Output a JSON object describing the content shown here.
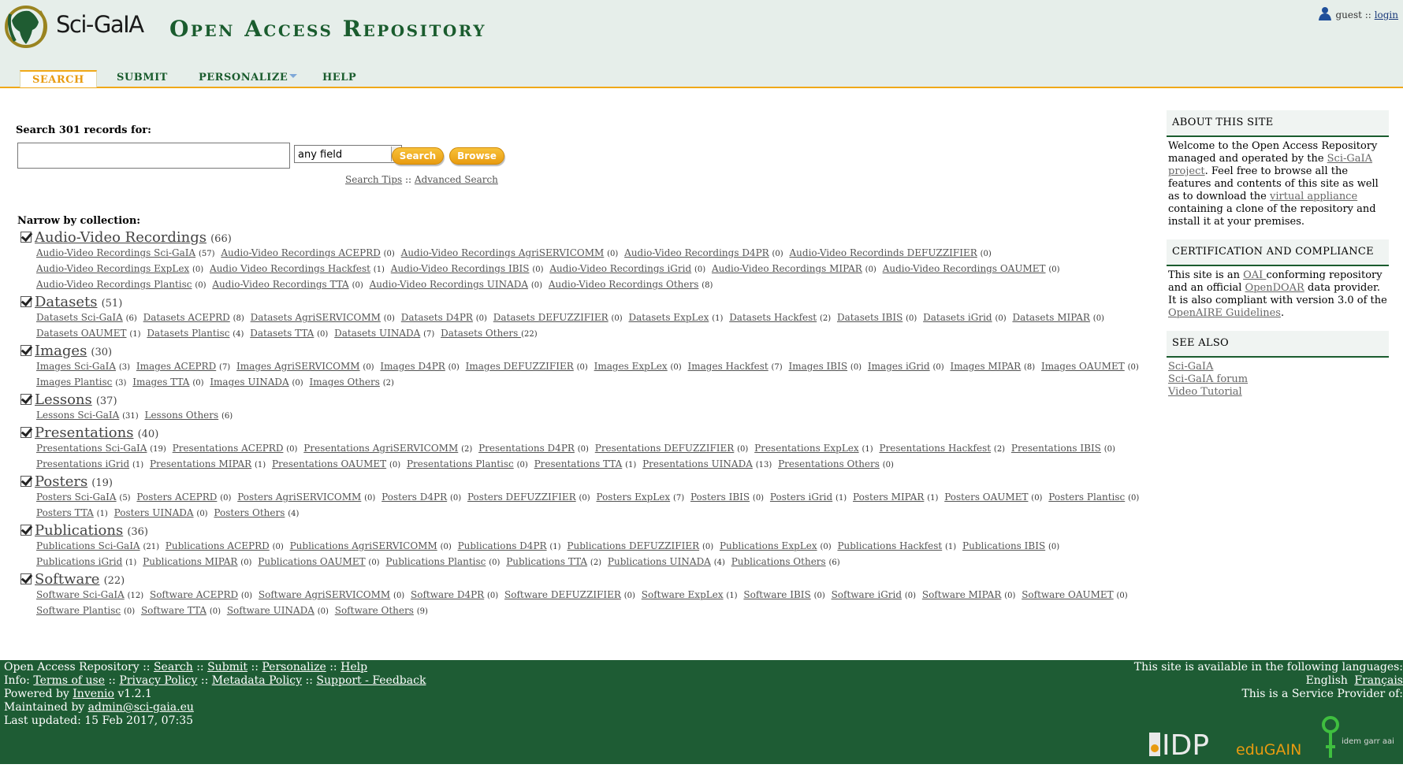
{
  "header": {
    "logo_text": "Sci-GaIA",
    "site_title": "Open Access Repository",
    "user": "guest",
    "separator": "::",
    "login_label": "login"
  },
  "nav": {
    "tabs": [
      {
        "label": "SEARCH",
        "active": true
      },
      {
        "label": "SUBMIT"
      },
      {
        "label": "PERSONALIZE",
        "has_menu": true
      },
      {
        "label": "HELP"
      }
    ]
  },
  "search": {
    "label": "Search 301 records for:",
    "input_value": "",
    "field_value": "any field",
    "search_button": "Search",
    "browse_button": "Browse",
    "tips_link": "Search Tips",
    "tips_sep": "::",
    "advanced_link": "Advanced Search"
  },
  "narrow_label": "Narrow by collection:",
  "collections": [
    {
      "name": "Audio-Video Recordings",
      "count": "(66)",
      "subs": [
        [
          "Audio-Video Recordings Sci-GaIA",
          "(57)"
        ],
        [
          "Audio-Video Recordings ACEPRD",
          "(0)"
        ],
        [
          "Audio-Video Recordings AgriSERVICOMM",
          "(0)"
        ],
        [
          "Audio-Video Recordings D4PR",
          "(0)"
        ],
        [
          "Audio-Video Recordinds DEFUZZIFIER",
          "(0)"
        ],
        [
          "Audio-Video Recordings ExpLex",
          "(0)"
        ],
        [
          "Audio Video Recordings Hackfest",
          "(1)"
        ],
        [
          "Audio-Video Recordings IBIS",
          "(0)"
        ],
        [
          "Audio-Video Recordings iGrid",
          "(0)"
        ],
        [
          "Audio-Video Recordings MIPAR",
          "(0)"
        ],
        [
          "Audio-Video Recordings OAUMET",
          "(0)"
        ],
        [
          "Audio-Video Recordings Plantisc",
          "(0)"
        ],
        [
          "Audio-Video Recordings TTA",
          "(0)"
        ],
        [
          "Audio-Video Recordings UINADA",
          "(0)"
        ],
        [
          "Audio-Video Recordings Others",
          "(8)"
        ]
      ]
    },
    {
      "name": "Datasets",
      "count": "(51)",
      "subs": [
        [
          "Datasets Sci-GaIA",
          "(6)"
        ],
        [
          "Datasets ACEPRD",
          "(8)"
        ],
        [
          "Datasets AgriSERVICOMM",
          "(0)"
        ],
        [
          "Datasets D4PR",
          "(0)"
        ],
        [
          "Datasets DEFUZZIFIER",
          "(0)"
        ],
        [
          "Datasets ExpLex",
          "(1)"
        ],
        [
          "Datasets Hackfest",
          "(2)"
        ],
        [
          "Datasets IBIS",
          "(0)"
        ],
        [
          "Datasets iGrid",
          "(0)"
        ],
        [
          "Datasets MIPAR",
          "(0)"
        ],
        [
          "Datasets OAUMET",
          "(1)"
        ],
        [
          "Datasets Plantisc",
          "(4)"
        ],
        [
          "Datasets TTA",
          "(0)"
        ],
        [
          "Datasets UINADA",
          "(7)"
        ],
        [
          "Datasets Others ",
          "(22)"
        ]
      ]
    },
    {
      "name": "Images",
      "count": "(30)",
      "subs": [
        [
          "Images Sci-GaIA",
          "(3)"
        ],
        [
          "Images ACEPRD",
          "(7)"
        ],
        [
          "Images AgriSERVICOMM",
          "(0)"
        ],
        [
          "Images D4PR",
          "(0)"
        ],
        [
          "Images DEFUZZIFIER",
          "(0)"
        ],
        [
          "Images ExpLex",
          "(0)"
        ],
        [
          "Images Hackfest",
          "(7)"
        ],
        [
          "Images IBIS",
          "(0)"
        ],
        [
          "Images iGrid",
          "(0)"
        ],
        [
          "Images MIPAR",
          "(8)"
        ],
        [
          "Images OAUMET",
          "(0)"
        ],
        [
          "Images Plantisc",
          "(3)"
        ],
        [
          "Images TTA",
          "(0)"
        ],
        [
          "Images UINADA",
          "(0)"
        ],
        [
          "Images Others",
          "(2)"
        ]
      ]
    },
    {
      "name": "Lessons",
      "count": "(37)",
      "subs": [
        [
          "Lessons Sci-GaIA",
          "(31)"
        ],
        [
          "Lessons Others",
          "(6)"
        ]
      ]
    },
    {
      "name": "Presentations",
      "count": "(40)",
      "subs": [
        [
          "Presentations Sci-GaIA",
          "(19)"
        ],
        [
          "Presentations ACEPRD",
          "(0)"
        ],
        [
          "Presentations AgriSERVICOMM",
          "(2)"
        ],
        [
          "Presentations D4PR",
          "(0)"
        ],
        [
          "Presentations DEFUZZIFIER",
          "(0)"
        ],
        [
          "Presentations ExpLex",
          "(1)"
        ],
        [
          "Presentations Hackfest",
          "(2)"
        ],
        [
          "Presentations IBIS",
          "(0)"
        ],
        [
          "Presentations iGrid",
          "(1)"
        ],
        [
          "Presentations MIPAR",
          "(1)"
        ],
        [
          "Presentations OAUMET",
          "(0)"
        ],
        [
          "Presentations Plantisc",
          "(0)"
        ],
        [
          "Presentations TTA",
          "(1)"
        ],
        [
          "Presentations UINADA",
          "(13)"
        ],
        [
          "Presentations Others",
          "(0)"
        ]
      ]
    },
    {
      "name": "Posters",
      "count": "(19)",
      "subs": [
        [
          "Posters Sci-GaIA",
          "(5)"
        ],
        [
          "Posters ACEPRD",
          "(0)"
        ],
        [
          "Posters AgriSERVICOMM",
          "(0)"
        ],
        [
          "Posters D4PR",
          "(0)"
        ],
        [
          "Posters DEFUZZIFIER",
          "(0)"
        ],
        [
          "Posters ExpLex",
          "(7)"
        ],
        [
          "Posters IBIS",
          "(0)"
        ],
        [
          "Posters iGrid",
          "(1)"
        ],
        [
          "Posters MIPAR",
          "(1)"
        ],
        [
          "Posters OAUMET",
          "(0)"
        ],
        [
          "Posters Plantisc",
          "(0)"
        ],
        [
          "Posters TTA",
          "(1)"
        ],
        [
          "Posters UINADA",
          "(0)"
        ],
        [
          "Posters Others",
          "(4)"
        ]
      ]
    },
    {
      "name": "Publications",
      "count": "(36)",
      "subs": [
        [
          "Publications Sci-GaIA",
          "(21)"
        ],
        [
          "Publications ACEPRD",
          "(0)"
        ],
        [
          "Publications AgriSERVICOMM",
          "(0)"
        ],
        [
          "Publications D4PR",
          "(1)"
        ],
        [
          "Publications DEFUZZIFIER",
          "(0)"
        ],
        [
          "Publications ExpLex",
          "(0)"
        ],
        [
          "Publications Hackfest",
          "(1)"
        ],
        [
          "Publications IBIS",
          "(0)"
        ],
        [
          "Publications iGrid",
          "(1)"
        ],
        [
          "Publications MIPAR",
          "(0)"
        ],
        [
          "Publications OAUMET",
          "(0)"
        ],
        [
          "Publications Plantisc",
          "(0)"
        ],
        [
          "Publications TTA",
          "(2)"
        ],
        [
          "Publications UINADA",
          "(4)"
        ],
        [
          "Publications Others",
          "(6)"
        ]
      ]
    },
    {
      "name": "Software",
      "count": "(22)",
      "subs": [
        [
          "Software Sci-GaIA",
          "(12)"
        ],
        [
          "Software ACEPRD",
          "(0)"
        ],
        [
          "Software AgriSERVICOMM",
          "(0)"
        ],
        [
          "Software D4PR",
          "(0)"
        ],
        [
          "Software DEFUZZIFIER",
          "(0)"
        ],
        [
          "Software ExpLex",
          "(1)"
        ],
        [
          "Software IBIS",
          "(0)"
        ],
        [
          "Software iGrid",
          "(0)"
        ],
        [
          "Software MIPAR",
          "(0)"
        ],
        [
          "Software OAUMET",
          "(0)"
        ],
        [
          "Software Plantisc",
          "(0)"
        ],
        [
          "Software TTA",
          "(0)"
        ],
        [
          "Software UINADA",
          "(0)"
        ],
        [
          "Software Others",
          "(9)"
        ]
      ]
    }
  ],
  "sidebar": {
    "about": {
      "title": "ABOUT THIS SITE",
      "t1": "Welcome to the Open Access Repository managed and operated by the ",
      "l1": "Sci-GaIA project",
      "t2": ". Feel free to browse all the features and contents of this site as well as to download the ",
      "l2": "virtual appliance",
      "t3": " containing a clone of the repository and install it at your premises."
    },
    "cert": {
      "title": "CERTIFICATION AND COMPLIANCE",
      "t1": "This site is an ",
      "l1": "OAI ",
      "t2": "conforming repository and an official ",
      "l2": "OpenDOAR",
      "t3": " data provider. It is also compliant with version 3.0 of the ",
      "l3": "OpenAIRE Guidelines",
      "t4": "."
    },
    "see_also": {
      "title": "SEE ALSO",
      "links": [
        "Sci-GaIA",
        "Sci-GaIA forum",
        "Video Tutorial"
      ]
    }
  },
  "footer": {
    "line1_prefix": "Open Access Repository",
    "sep": "::",
    "line1_links": [
      "Search",
      "Submit",
      "Personalize",
      "Help"
    ],
    "info_label": "Info:",
    "line2_links": [
      "Terms of use",
      "Privacy Policy",
      "Metadata Policy",
      "Support - Feedback"
    ],
    "powered_label": "Powered by",
    "powered_link": "Invenio",
    "version": "v1.2.1",
    "maintained_label": "Maintained by",
    "maintained_link": "admin@sci-gaia.eu",
    "last_updated": "Last updated: 15 Feb 2017, 07:35",
    "languages_text": "This site is available in the following languages:",
    "languages": [
      "English",
      "Français"
    ],
    "provider_text": "This is a Service Provider of:",
    "logos": [
      "IDP",
      "eduGAIN",
      "idem garr aai"
    ]
  }
}
